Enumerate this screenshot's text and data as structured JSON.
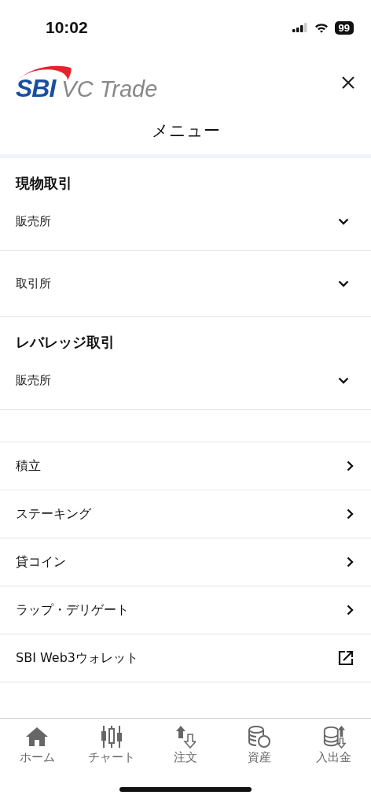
{
  "status_bar": {
    "time": "10:02",
    "battery": "99"
  },
  "header": {
    "logo_mark": "SBI",
    "logo_text": "VC Trade",
    "title": "メニュー"
  },
  "sections": [
    {
      "title": "現物取引",
      "items": [
        {
          "label": "販売所",
          "kind": "expand"
        },
        {
          "label": "取引所",
          "kind": "expand"
        }
      ]
    },
    {
      "title": "レバレッジ取引",
      "items": [
        {
          "label": "販売所",
          "kind": "expand"
        }
      ]
    }
  ],
  "links": [
    {
      "label": "積立",
      "kind": "chevron"
    },
    {
      "label": "ステーキング",
      "kind": "chevron"
    },
    {
      "label": "貸コイン",
      "kind": "chevron"
    },
    {
      "label": "ラップ・デリゲート",
      "kind": "chevron"
    },
    {
      "label": "SBI Web3ウォレット",
      "kind": "external"
    }
  ],
  "tab_bar": [
    {
      "label": "ホーム",
      "kind": "home"
    },
    {
      "label": "チャート",
      "kind": "chart"
    },
    {
      "label": "注文",
      "kind": "order"
    },
    {
      "label": "資産",
      "kind": "assets"
    },
    {
      "label": "入出金",
      "kind": "deposit"
    }
  ]
}
